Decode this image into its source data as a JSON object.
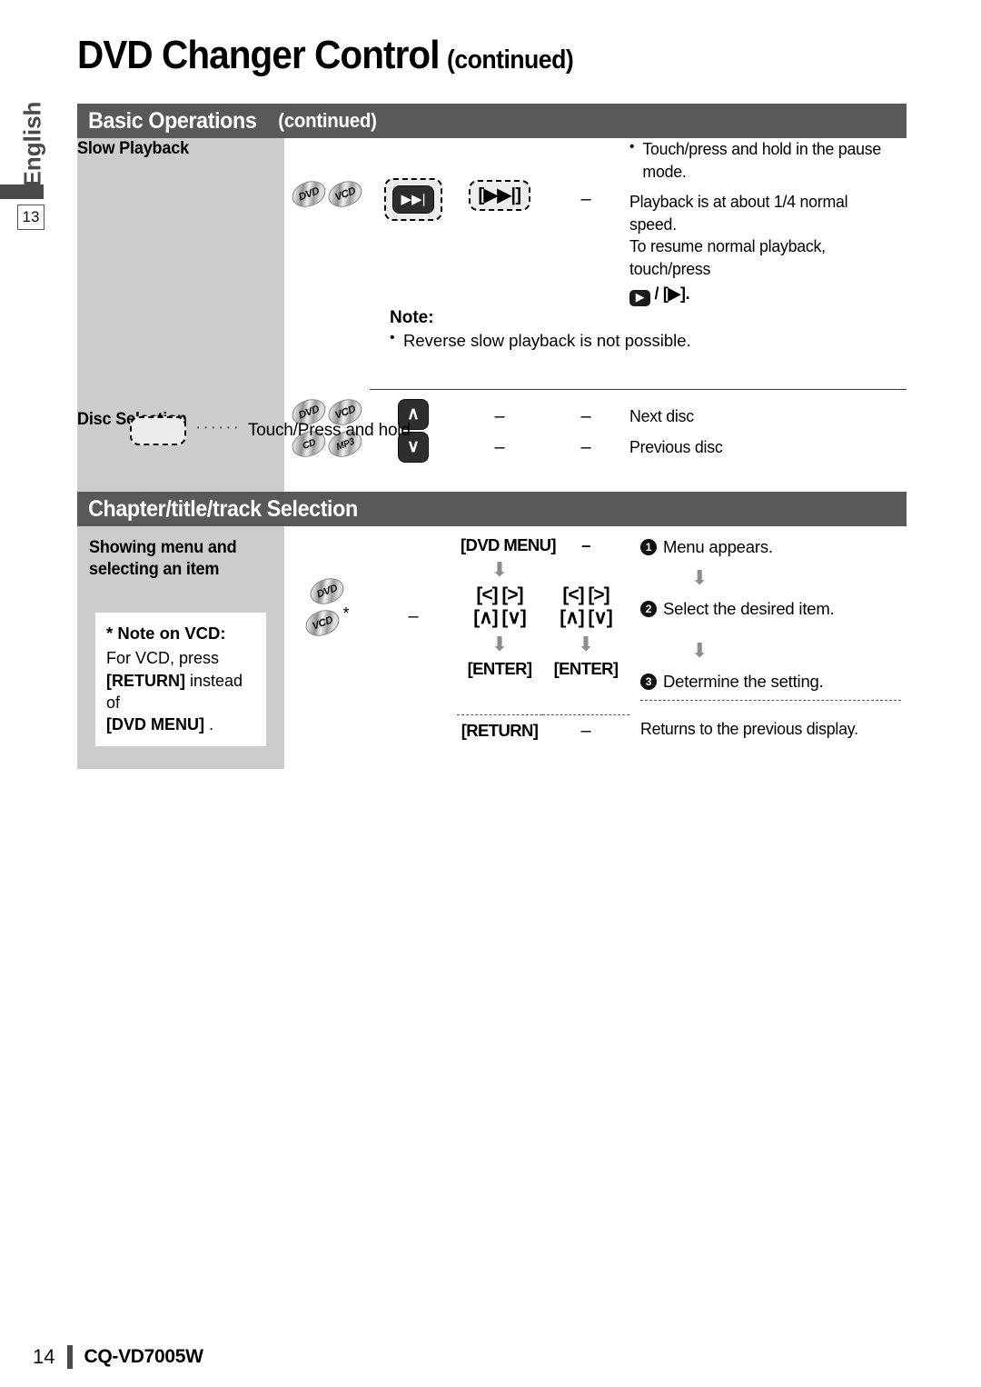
{
  "sidebar": {
    "language": "English",
    "chapter_number": "13"
  },
  "title": {
    "main": "DVD Changer Control",
    "suffix": "(continued)"
  },
  "sections": [
    {
      "bar_title": "Basic Operations",
      "bar_suffix": "(continued)"
    },
    {
      "bar_title": "Chapter/title/track Selection",
      "bar_suffix": ""
    }
  ],
  "basic_operations": {
    "slow_playback": {
      "label": "Slow Playback",
      "discs": [
        "DVD",
        "VCD"
      ],
      "button_touch": "▶▶|",
      "button_bracket": "[▶▶|]",
      "col3": "–",
      "desc_bullet": "Touch/press and hold in the pause mode.",
      "desc_line1": "Playback is at about 1/4 normal speed.",
      "desc_line2": "To resume normal playback, touch/press",
      "desc_play_btn": "▶",
      "desc_play_bracket": "/ [▶].",
      "note_title": "Note:",
      "note_body": "Reverse slow playback is not possible."
    },
    "disc_selection": {
      "label": "Disc Selection",
      "discs_row1": [
        "DVD",
        "VCD"
      ],
      "discs_row2": [
        "CD",
        "MP3"
      ],
      "up_button": "∧",
      "down_button": "∨",
      "rows": [
        {
          "col2": "–",
          "col3": "–",
          "desc": "Next disc"
        },
        {
          "col2": "–",
          "col3": "–",
          "desc": "Previous disc"
        }
      ]
    },
    "legend": {
      "dots": "······",
      "text": "Touch/Press and hold"
    }
  },
  "chapter_selection": {
    "label": "Showing menu and selecting an item",
    "vcd_note": {
      "title": "* Note on VCD:",
      "line1": "For VCD,  press",
      "bold1": "[RETURN]",
      "mid1": " instead of",
      "bold2": "[DVD MENU]",
      "mid2": " ."
    },
    "discs": [
      "DVD",
      "VCD"
    ],
    "disc_asterisk": "*",
    "col_dash": "–",
    "flow_col1": {
      "key1": "[DVD MENU]",
      "arrow1": "⬇",
      "key2_line1": "[<] [>]",
      "key2_line2": "[∧] [∨]",
      "arrow2": "⬇",
      "key3": "[ENTER]"
    },
    "flow_col2": {
      "key1": "–",
      "key2_line1": "[<] [>]",
      "key2_line2": "[∧] [∨]",
      "arrow2": "⬇",
      "key3": "[ENTER]"
    },
    "steps": [
      {
        "num": "❶",
        "text": "Menu appears."
      },
      {
        "num": "❷",
        "text": "Select the desired item."
      },
      {
        "num": "❸",
        "text": "Determine the setting."
      }
    ],
    "arrow_glyph": "⬇",
    "return_row": {
      "key": "[RETURN]",
      "col2": "–",
      "desc": "Returns to the previous display."
    }
  },
  "footer": {
    "page_number": "14",
    "model": "CQ-VD7005W"
  },
  "colors": {
    "header_bar": "#595959",
    "label_cell": "#cccccc",
    "rule": "#3b3b3b"
  }
}
